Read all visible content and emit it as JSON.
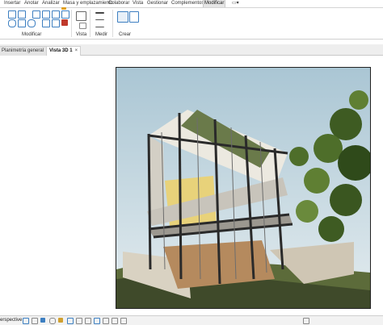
{
  "menu": {
    "items": [
      "Insertar",
      "Anotar",
      "Analizar",
      "Masa y emplazamiento",
      "Colaborar",
      "Vista",
      "Gestionar",
      "Complementos",
      "Modificar"
    ],
    "active": "Modificar",
    "extra": "▭▾"
  },
  "ribbon": {
    "groups": [
      "Modificar",
      "Vista",
      "Medir",
      "Crear"
    ]
  },
  "tabs": [
    {
      "label": "Planimetría general"
    },
    {
      "label": "Vista 3D 1",
      "close": "×"
    }
  ],
  "status": {
    "text": "erspective"
  },
  "colors": {
    "accent": "#3d7fc1",
    "sky": "#c9dbe4",
    "grass": "#5c6b3a"
  }
}
